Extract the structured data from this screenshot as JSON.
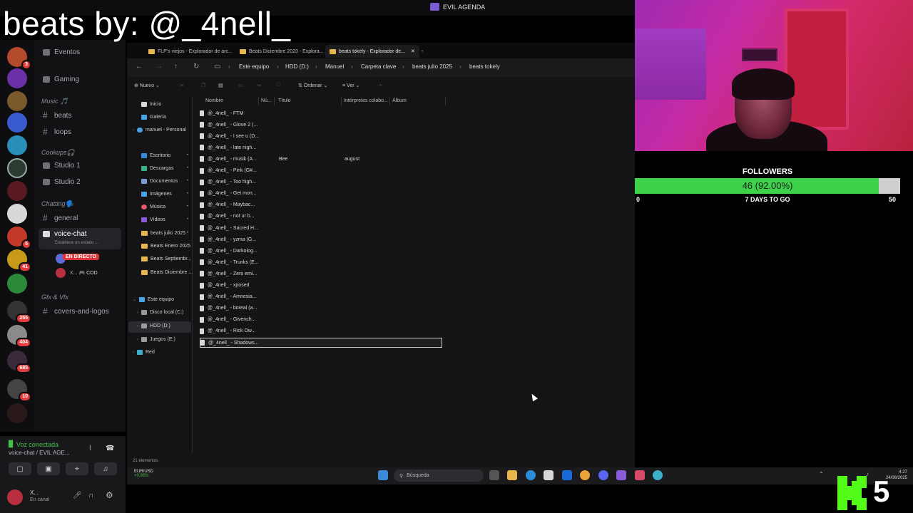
{
  "overlay": {
    "title": "beats by: @_4nell_"
  },
  "discord": {
    "server_title": "EVIL AGENDA",
    "channels": [
      {
        "kind": "text-ish",
        "label": "Eventos"
      },
      {
        "kind": "voice",
        "label": "Gaming"
      }
    ],
    "categories": {
      "music": "Music 🎵",
      "cookups": "Cookups🎧",
      "chatting": "Chatting🗣️",
      "gfx": "Gfx & Vfx"
    },
    "music_channels": [
      "beats",
      "loops"
    ],
    "cookup_channels": [
      "Studio 1",
      "Studio 2"
    ],
    "chatting_channels": [
      "general"
    ],
    "voice_chat": {
      "label": "voice-chat",
      "status": "Establece un estado ..."
    },
    "live_badge": "EN DIRECTO",
    "voice_users": [
      {
        "name": "..."
      },
      {
        "name": "X...",
        "activity": "🎮 COD"
      }
    ],
    "gfx_channels": [
      "covers-and-logos"
    ],
    "server_badges": [
      "3",
      "5",
      "41",
      "255",
      "404",
      "685",
      "10"
    ],
    "voice_panel": {
      "status": "Voz conectada",
      "channel": "voice-chat / EVIL AGE...",
      "user": "X...",
      "user_status": "En canal"
    }
  },
  "explorer": {
    "tabs": [
      "FLP's viejos - Explorador de arc...",
      "Beats Diciembre 2023 - Explora...",
      "beats tokely - Explorador de..."
    ],
    "breadcrumb": [
      "Este equipo",
      "HDD (D:)",
      "Manuel",
      "Carpeta clave",
      "beats julio 2025",
      "beats tokely"
    ],
    "toolbar": {
      "new": "Nuevo",
      "sort": "Ordenar",
      "view": "Ver",
      "more": "···"
    },
    "nav": [
      "Inicio",
      "Galería",
      "manuel - Personal",
      "Escritorio",
      "Descargas",
      "Documentos",
      "Imágenes",
      "Música",
      "Vídeos",
      "beats julio 2025",
      "Beats Enero 2025",
      "Beats Septiembr...",
      "Beats Diciembre ...",
      "Este equipo",
      "Disco local (C:)",
      "HDD (D:)",
      "Juegos (E:)",
      "Red"
    ],
    "columns": [
      "Nombre",
      "Nú...",
      "Título",
      "Intérpretes colabo...",
      "Álbum"
    ],
    "files": [
      {
        "name": "@_4nell_ - FTM",
        "title": "",
        "artist": ""
      },
      {
        "name": "@_4nell_ - Glove 2 (...",
        "title": "",
        "artist": ""
      },
      {
        "name": "@_4nell_ - I see u (D...",
        "title": "",
        "artist": ""
      },
      {
        "name": "@_4nell_ - late nigh...",
        "title": "",
        "artist": ""
      },
      {
        "name": "@_4nell_ - musik (A...",
        "title": "Bee",
        "artist": "august"
      },
      {
        "name": "@_4nell_ - Pink (G#...",
        "title": "",
        "artist": ""
      },
      {
        "name": "@_4nell_ - Too high...",
        "title": "",
        "artist": ""
      },
      {
        "name": "@_4nell_ - Get mon...",
        "title": "",
        "artist": ""
      },
      {
        "name": "@_4nell_ - Maybac...",
        "title": "",
        "artist": ""
      },
      {
        "name": "@_4nell_ - not ur b...",
        "title": "",
        "artist": ""
      },
      {
        "name": "@_4nell_ - Sacred H...",
        "title": "",
        "artist": ""
      },
      {
        "name": "@_4nell_ - yzma (G...",
        "title": "",
        "artist": ""
      },
      {
        "name": "@_4nell_ - Darkolog...",
        "title": "",
        "artist": ""
      },
      {
        "name": "@_4nell_ - Trunks (E...",
        "title": "",
        "artist": ""
      },
      {
        "name": "@_4nell_ - Zero emi...",
        "title": "",
        "artist": ""
      },
      {
        "name": "@_4nell_ - xposed",
        "title": "",
        "artist": ""
      },
      {
        "name": "@_4nell_ - Amnesia...",
        "title": "",
        "artist": ""
      },
      {
        "name": "@_4nell_ - boreal (a...",
        "title": "",
        "artist": ""
      },
      {
        "name": "@_4nell_ - Givench...",
        "title": "",
        "artist": ""
      },
      {
        "name": "@_4nell_ - Rick Ow...",
        "title": "",
        "artist": ""
      },
      {
        "name": "@_4nell_ - Shadows...",
        "title": "",
        "artist": ""
      }
    ],
    "selected_index": 20,
    "status": "21 elementos"
  },
  "taskbar": {
    "weather_label": "EUR/USD",
    "weather_change": "+0,95%",
    "search_placeholder": "Búsqueda",
    "time": "4:27",
    "date": "24/08/2025"
  },
  "followers": {
    "title": "FOLLOWERS",
    "current": 46,
    "goal": 50,
    "progress_fraction": 0.92,
    "bar_text": "46 (92.00%)",
    "min_label": "0",
    "max_label": "50",
    "subtitle": "7 DAYS TO GO",
    "fill_color": "#3ed24a"
  },
  "kick": {
    "count": "5",
    "brand_color": "#53fc18"
  }
}
